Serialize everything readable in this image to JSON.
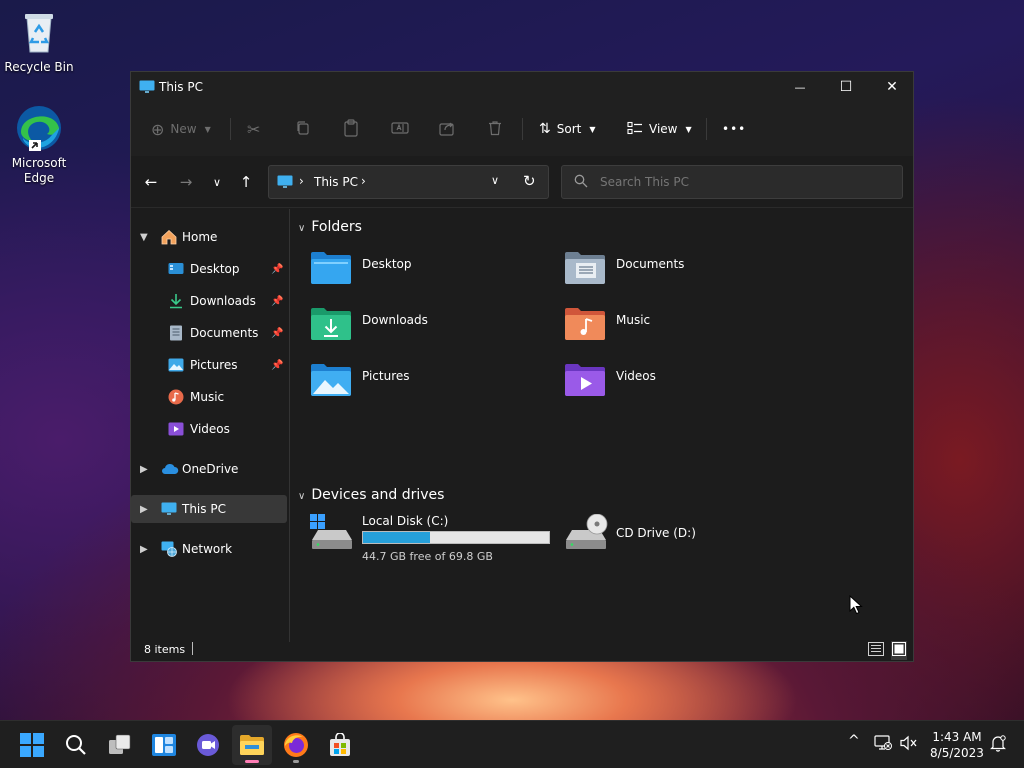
{
  "desktop": {
    "icons": [
      {
        "label": "Recycle Bin"
      },
      {
        "label": "Microsoft Edge"
      }
    ]
  },
  "window": {
    "title": "This PC",
    "controls": {
      "minimize": "—",
      "maximize": "☐",
      "close": "✕"
    }
  },
  "commandbar": {
    "new_label": "New",
    "sort_label": "Sort",
    "view_label": "View",
    "more_label": "•••"
  },
  "navbar": {
    "address": {
      "crumb": "This PC"
    },
    "search": {
      "placeholder": "Search This PC"
    }
  },
  "sidebar": {
    "items": [
      {
        "label": "Home"
      },
      {
        "label": "Desktop"
      },
      {
        "label": "Downloads"
      },
      {
        "label": "Documents"
      },
      {
        "label": "Pictures"
      },
      {
        "label": "Music"
      },
      {
        "label": "Videos"
      },
      {
        "label": "OneDrive"
      },
      {
        "label": "This PC"
      },
      {
        "label": "Network"
      }
    ]
  },
  "content": {
    "folders_header": "Folders",
    "folders": [
      {
        "label": "Desktop"
      },
      {
        "label": "Documents"
      },
      {
        "label": "Downloads"
      },
      {
        "label": "Music"
      },
      {
        "label": "Pictures"
      },
      {
        "label": "Videos"
      }
    ],
    "devices_header": "Devices and drives",
    "drives": [
      {
        "label": "Local Disk (C:)",
        "free_text": "44.7 GB free of 69.8 GB",
        "used_fraction": 0.36
      },
      {
        "label": "CD Drive (D:)"
      }
    ]
  },
  "statusbar": {
    "items_text": "8 items"
  },
  "taskbar": {
    "clock": {
      "time": "1:43 AM",
      "date": "8/5/2023"
    }
  },
  "colors": {
    "accent": "#2b9de0",
    "window_bg": "#1c1c1c",
    "selected_bg": "#383838",
    "taskbar_bg": "#1f1f1f"
  }
}
